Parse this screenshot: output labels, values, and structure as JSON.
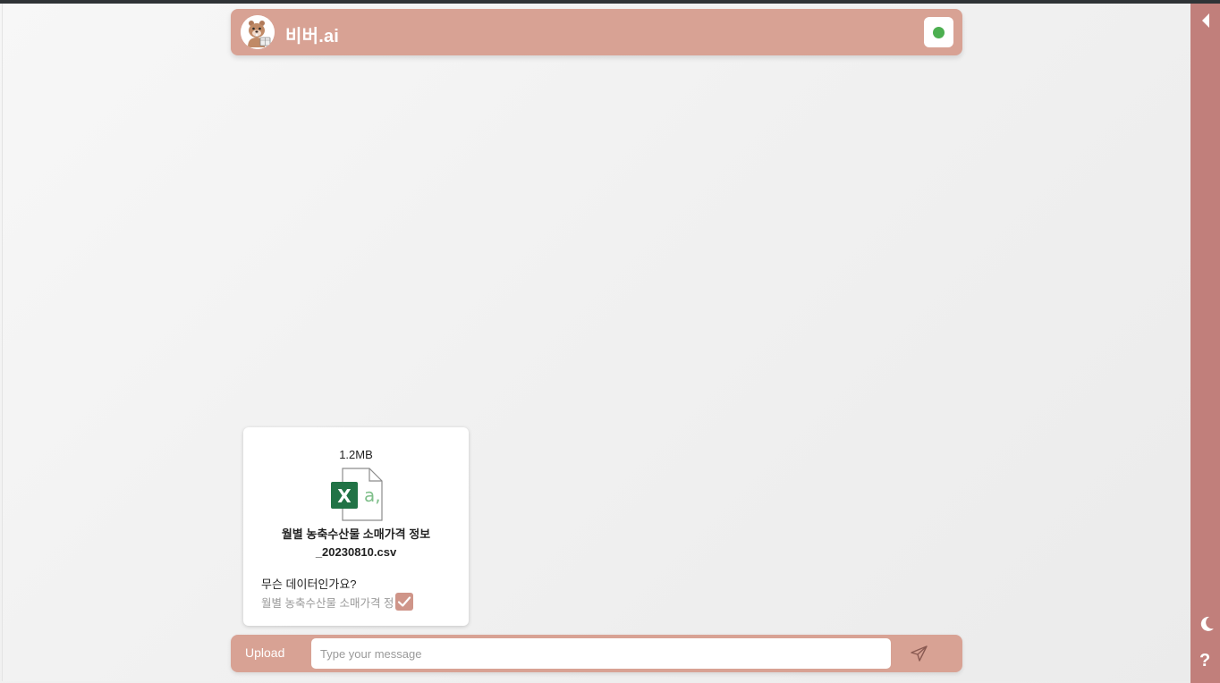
{
  "header": {
    "brand": "비버.ai",
    "avatar_icon": "beaver-avatar-icon",
    "status_color": "#4caf50"
  },
  "file_card": {
    "size": "1.2MB",
    "file_icon": "excel-file-icon",
    "name_line1": "월별 농축수산물 소매가격 정보",
    "name_line2": "_20230810.csv",
    "question": "무슨 데이터인가요?",
    "answer": "월별 농축수산물 소매가격 정보",
    "checked": true
  },
  "input_bar": {
    "upload_label": "Upload",
    "placeholder": "Type your message",
    "value": ""
  },
  "sidebar": {
    "help_label": "?"
  },
  "colors": {
    "accent": "#d8a294",
    "sidebar": "#c17f7b",
    "checkbox": "#cf9589",
    "status_online": "#4caf50"
  }
}
